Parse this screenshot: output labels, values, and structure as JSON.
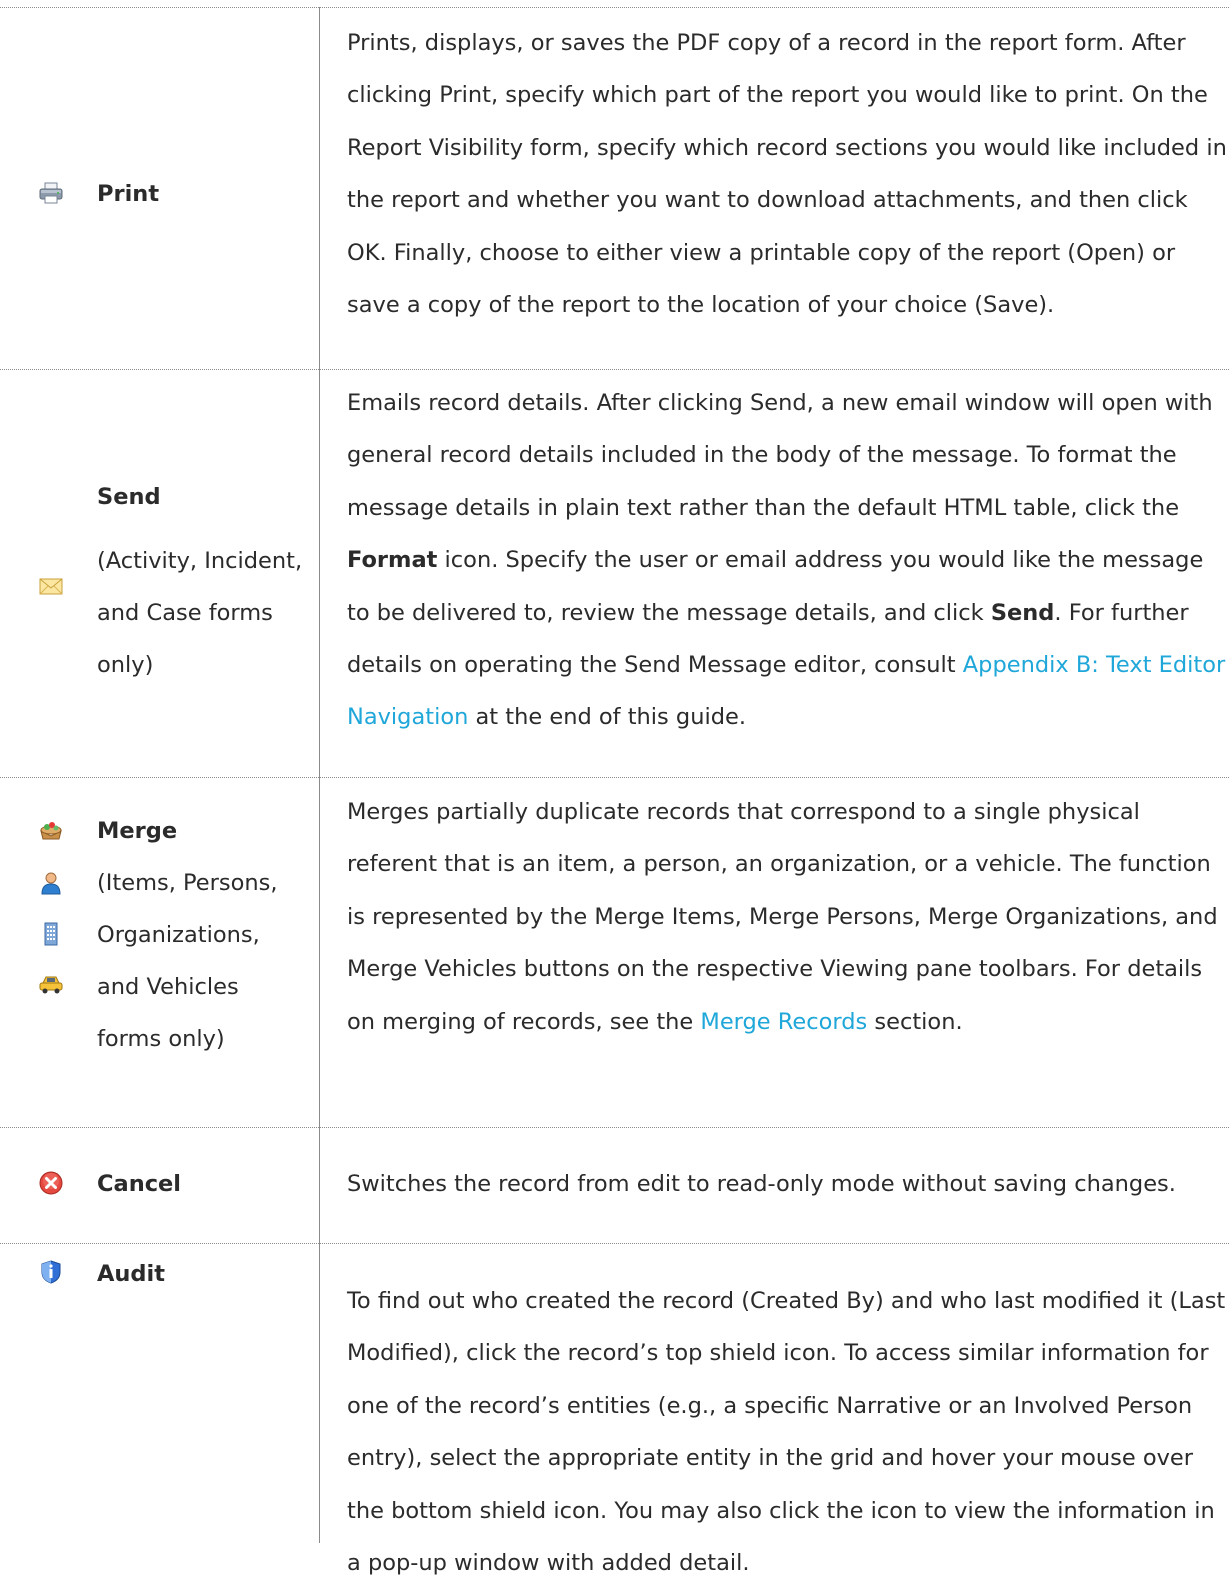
{
  "rows": [
    {
      "name": "Print",
      "icon": "printer-icon",
      "description": "Prints, displays, or saves the PDF copy of a record in the report form. After clicking Print, specify which part of the report you would like to print. On the Report Visibility form, specify which record sections you would like included in the report and whether you want to download attachments, and then click OK. Finally, choose to either view a printable copy of the report (Open) or save a copy of the report to the location of your choice (Save)."
    },
    {
      "name": "Send",
      "note": "(Activity, Incident, and Case forms only)",
      "icon": "envelope-icon",
      "desc_1": "Emails record details. After clicking Send, a new email window will open with general record details included in the body of the message. To format the message details in plain text rather than the default HTML table, click the ",
      "bold_1": "Format",
      "desc_2": " icon. Specify the user or email address you would like the message to be delivered to, review the message details, and click ",
      "bold_2": "Send",
      "desc_3": ". For further details on operating the Send Message editor, consult ",
      "link": "Appendix B: Text Editor Navigation",
      "desc_4": " at the end of this guide."
    },
    {
      "name": "Merge",
      "note": "(Items, Persons, Organizations, and Vehicles forms only)",
      "icons": [
        "items-icon",
        "person-icon",
        "organization-icon",
        "vehicle-icon"
      ],
      "desc_1": "Merges partially duplicate records that correspond to a single physical referent that is an item, a person, an organization, or a vehicle. The function is represented by the Merge Items, Merge Persons, Merge Organizations, and Merge Vehicles buttons on the respective Viewing pane toolbars. For details on merging of records, see the ",
      "link": "Merge Records",
      "desc_2": " section."
    },
    {
      "name": "Cancel",
      "icon": "cancel-icon",
      "description": "Switches the record from edit to read-only mode without saving changes."
    },
    {
      "name": "Audit",
      "icon": "shield-icon",
      "description": "To find out who created the record (Created By) and who last modified it (Last Modified), click the record’s top shield icon. To access similar information for one of the record’s entities (e.g., a specific Narrative or an Involved Person entry), select the appropriate entity in the grid and hover your mouse over the bottom shield icon. You may also click the icon to view the information in a pop-up window with added detail."
    }
  ],
  "colors": {
    "link": "#1fa7d9",
    "text": "#2b2b2b",
    "rule": "#8a8a8a"
  }
}
